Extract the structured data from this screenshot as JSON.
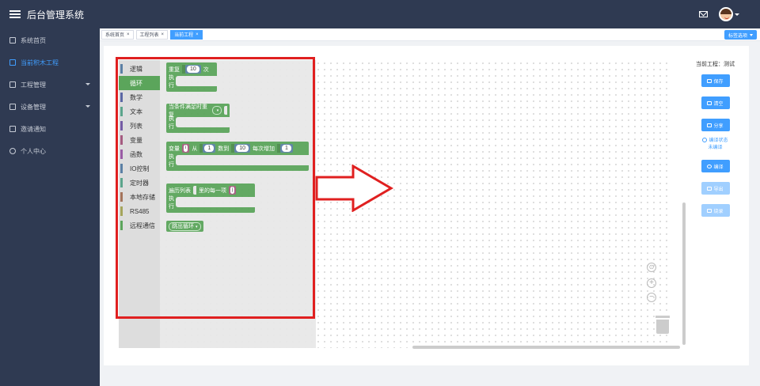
{
  "header": {
    "title": "后台管理系统",
    "menu_icon": "hamburger-icon",
    "mail_icon": "mail-icon",
    "avatar_icon": "user-avatar"
  },
  "sidebar": {
    "items": [
      {
        "label": "系统首页",
        "icon": "home-icon"
      },
      {
        "label": "当前积木工程",
        "icon": "project-icon",
        "active": true
      },
      {
        "label": "工程管理",
        "icon": "folder-icon",
        "has_children": true
      },
      {
        "label": "设备管理",
        "icon": "list-icon",
        "has_children": true
      },
      {
        "label": "邀请通知",
        "icon": "mail-icon"
      },
      {
        "label": "个人中心",
        "icon": "user-icon"
      }
    ]
  },
  "tabs": {
    "items": [
      {
        "label": "系统首页",
        "close": "×"
      },
      {
        "label": "工程列表",
        "close": "×"
      },
      {
        "label": "当前工程",
        "close": "×",
        "active": true
      }
    ],
    "options_label": "标签选项"
  },
  "toolbox": {
    "categories": [
      {
        "label": "逻辑",
        "color": "#5b80a5"
      },
      {
        "label": "循环",
        "color": "#5ba55b",
        "selected": true
      },
      {
        "label": "数学",
        "color": "#5b67a5"
      },
      {
        "label": "文本",
        "color": "#5ba58c"
      },
      {
        "label": "列表",
        "color": "#745ba5"
      },
      {
        "label": "变量",
        "color": "#a55b80"
      },
      {
        "label": "函数",
        "color": "#995ba5"
      },
      {
        "label": "IO控制",
        "color": "#5b80a5"
      },
      {
        "label": "定时器",
        "color": "#5ba58c"
      },
      {
        "label": "本地存储",
        "color": "#a5745b"
      },
      {
        "label": "RS485",
        "color": "#a5a55b"
      },
      {
        "label": "远程通信",
        "color": "#5ba55b"
      }
    ]
  },
  "blocks": {
    "repeat": {
      "label": "重复",
      "value": "10",
      "suffix": "次",
      "exec": "执行"
    },
    "while": {
      "label": "当条件满足时重复",
      "exec": "执行"
    },
    "for": {
      "label": "变量",
      "var": "i",
      "from": "从",
      "from_val": "1",
      "to": "数到",
      "to_val": "10",
      "step": "每次增加",
      "step_val": "1",
      "exec": "执行"
    },
    "foreach": {
      "label": "遍历列表",
      "item": "里的每一项",
      "var": "j",
      "exec": "执行"
    },
    "break": {
      "label": "跳出循环"
    }
  },
  "workspace": {
    "zoom_reset_icon": "target-icon",
    "zoom_in_icon": "plus-circle-icon",
    "zoom_out_icon": "minus-circle-icon",
    "trash_icon": "trash-icon"
  },
  "right_panel": {
    "project_label": "当前工程：测试",
    "save": "保存",
    "clear": "清空",
    "share": "分享",
    "compile_status": "编译状态",
    "compile_value": "未编译",
    "compile": "编译",
    "export": "导出",
    "download": "烧录"
  }
}
